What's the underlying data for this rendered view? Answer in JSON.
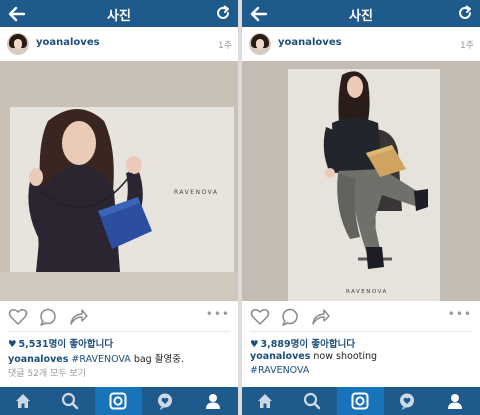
{
  "screen_title": "사진",
  "posts": [
    {
      "username": "yoanaloves",
      "time_ago": "1주",
      "brand_label": "RAVENOVA",
      "likes": "5,531명이 좋아합니다",
      "caption_user": "yoanaloves",
      "caption_hashtag": "#RAVENOVA",
      "caption_text": " bag 촬영중.",
      "comments_label": "댓글 52개 모두 보기"
    },
    {
      "username": "yoanaloves",
      "time_ago": "1주",
      "brand_label": "RAVENOVA",
      "likes": "3,889명이 좋아합니다",
      "caption_user": "yoanaloves",
      "caption_text": " now shooting",
      "caption_hashtag": "#RAVENOVA"
    }
  ],
  "more_label": "•••",
  "tabs": [
    "home-icon",
    "search-icon",
    "camera-icon",
    "activity-icon",
    "profile-icon"
  ],
  "colors": {
    "bar": "#1f5a8d",
    "active_tab": "#1874b8",
    "link": "#1d4f7c"
  }
}
